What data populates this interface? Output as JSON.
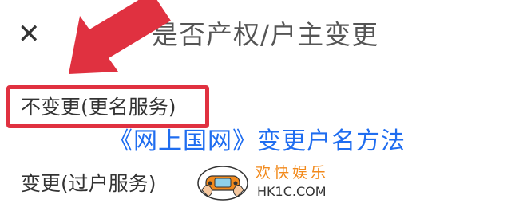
{
  "header": {
    "close_icon": "close-icon",
    "title": "是否产权/户主变更"
  },
  "options": [
    {
      "label": "不变更(更名服务)",
      "highlighted": true
    },
    {
      "label": "变更(过户服务)",
      "highlighted": false
    }
  ],
  "overlay": {
    "caption": "《网上国网》变更户名方法",
    "arrow_color": "#e03140",
    "highlight_color": "#e03140",
    "caption_color": "#1f6df0"
  },
  "watermark": {
    "brand": "欢快娱乐",
    "domain": "HK1C.COM",
    "icon": "gamepad-hands-icon"
  }
}
